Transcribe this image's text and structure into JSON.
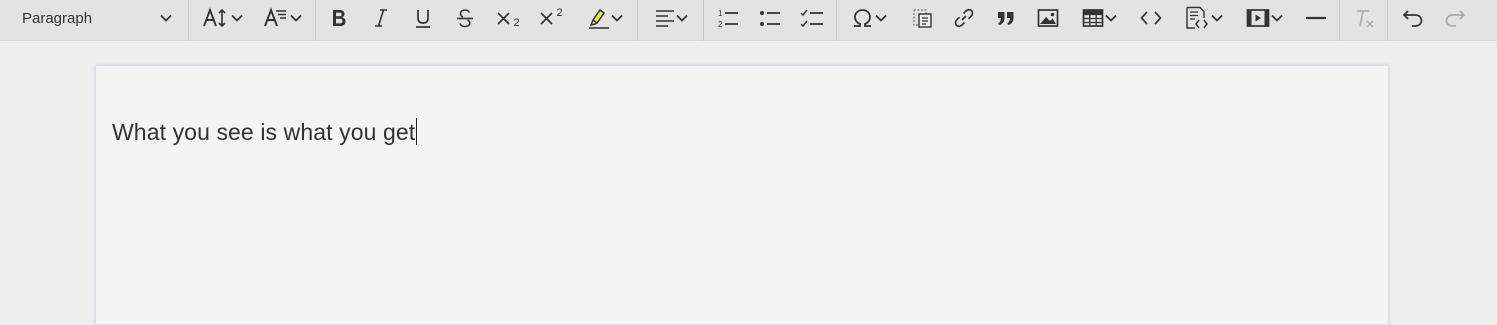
{
  "toolbar": {
    "heading": {
      "selected": "Paragraph",
      "icon": "chevron-down-icon"
    },
    "buttons": [
      {
        "name": "font-size",
        "icon": "font-size-icon"
      },
      {
        "name": "font-family",
        "icon": "font-family-icon"
      },
      {
        "name": "bold",
        "icon": "bold-icon"
      },
      {
        "name": "italic",
        "icon": "italic-icon"
      },
      {
        "name": "underline",
        "icon": "underline-icon"
      },
      {
        "name": "strikethrough",
        "icon": "strikethrough-icon"
      },
      {
        "name": "subscript",
        "icon": "subscript-icon"
      },
      {
        "name": "superscript",
        "icon": "superscript-icon"
      },
      {
        "name": "highlight",
        "icon": "highlighter-icon",
        "color": "#f5e642"
      },
      {
        "name": "alignment",
        "icon": "align-left-icon"
      },
      {
        "name": "numbered-list",
        "icon": "numbered-list-icon"
      },
      {
        "name": "bulleted-list",
        "icon": "bulleted-list-icon"
      },
      {
        "name": "todo-list",
        "icon": "checklist-icon"
      },
      {
        "name": "special-characters",
        "icon": "omega-icon"
      },
      {
        "name": "paste-plain-text",
        "icon": "paste-icon"
      },
      {
        "name": "link",
        "icon": "link-icon"
      },
      {
        "name": "block-quote",
        "icon": "quote-icon"
      },
      {
        "name": "insert-image",
        "icon": "image-icon"
      },
      {
        "name": "insert-table",
        "icon": "table-icon"
      },
      {
        "name": "code",
        "icon": "code-icon"
      },
      {
        "name": "code-block",
        "icon": "code-block-icon"
      },
      {
        "name": "media-embed",
        "icon": "media-icon"
      },
      {
        "name": "horizontal-line",
        "icon": "horizontal-line-icon"
      },
      {
        "name": "remove-format",
        "icon": "remove-format-icon"
      },
      {
        "name": "undo",
        "icon": "undo-icon"
      },
      {
        "name": "redo",
        "icon": "redo-icon"
      }
    ],
    "subscript_digit": "2",
    "superscript_digit": "2"
  },
  "editor": {
    "content": "What you see is what you get"
  }
}
